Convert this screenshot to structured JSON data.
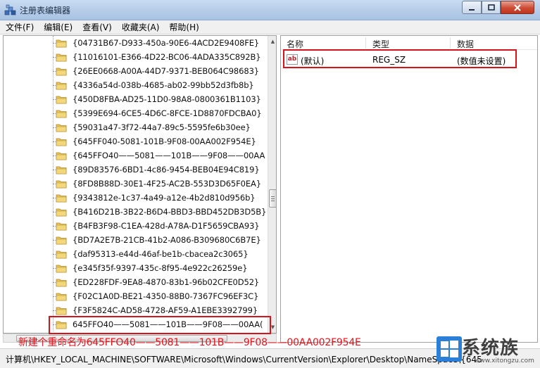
{
  "window": {
    "title": "注册表编辑器"
  },
  "menu": [
    {
      "label": "文件(F)"
    },
    {
      "label": "编辑(E)"
    },
    {
      "label": "查看(V)"
    },
    {
      "label": "收藏夹(A)"
    },
    {
      "label": "帮助(H)"
    }
  ],
  "tree": {
    "items": [
      {
        "label": "{04731B67-D933-450a-90E6-4ACD2E9408FE}"
      },
      {
        "label": "{11016101-E366-4D22-BC06-4ADA335C892B}"
      },
      {
        "label": "{26EE0668-A00A-44D7-9371-BEB064C98683}"
      },
      {
        "label": "{4336a54d-038b-4685-ab02-99bb52d3fb8b}"
      },
      {
        "label": "{450D8FBA-AD25-11D0-98A8-0800361B1103}"
      },
      {
        "label": "{5399E694-6CE5-4D6C-8FCE-1D8870FDCBA0}"
      },
      {
        "label": "{59031a47-3f72-44a7-89c5-5595fe6b30ee}"
      },
      {
        "label": "{645FF040-5081-101B-9F08-00AA002F954E}"
      },
      {
        "label": "{645FFO40——5081——101B——9F08——00AA"
      },
      {
        "label": "{89D83576-6BD1-4c86-9454-BEB04E94C819}"
      },
      {
        "label": "{8FD8B88D-30E1-4F25-AC2B-553D3D65F0EA}"
      },
      {
        "label": "{9343812e-1c37-4a49-a12e-4b2d810d956b}"
      },
      {
        "label": "{B416D21B-3B22-B6D4-BBD3-BBD452DB3D5B}"
      },
      {
        "label": "{B4FB3F98-C1EA-428d-A78A-D1F5659CBA93}"
      },
      {
        "label": "{BD7A2E7B-21CB-41b2-A086-B309680C6B7E}"
      },
      {
        "label": "{daf95313-e44d-46af-be1b-cbacea2c3065}"
      },
      {
        "label": "{e345f35f-9397-435c-8f95-4e922c26259e}"
      },
      {
        "label": "{ED228FDF-9EA8-4870-83b1-96b02CFE0D52}"
      },
      {
        "label": "{F02C1A0D-BE21-4350-88B0-7367FC96EF3C}"
      },
      {
        "label": "{F3F5824C-AD58-4728-AF59-A1EBE3392799}"
      },
      {
        "label": "645FFO40——5081——101B——9F08——00AA("
      }
    ]
  },
  "list": {
    "columns": [
      "名称",
      "类型",
      "数据"
    ],
    "rows": [
      {
        "name": "(默认)",
        "type": "REG_SZ",
        "data": "(数值未设置)",
        "icon": "ab-string-icon"
      }
    ]
  },
  "annotation": "新建个重命名为645FFO40——5081——101B——9F08——00AA002F954E",
  "status": "计算机\\HKEY_LOCAL_MACHINE\\SOFTWARE\\Microsoft\\Windows\\CurrentVersion\\Explorer\\Desktop\\NameSpace\\{645",
  "watermark": {
    "text": "系统族",
    "sub": "www.xitongzu.com"
  },
  "colors": {
    "highlight": "#d4131b",
    "folder": "#e8c35a"
  }
}
